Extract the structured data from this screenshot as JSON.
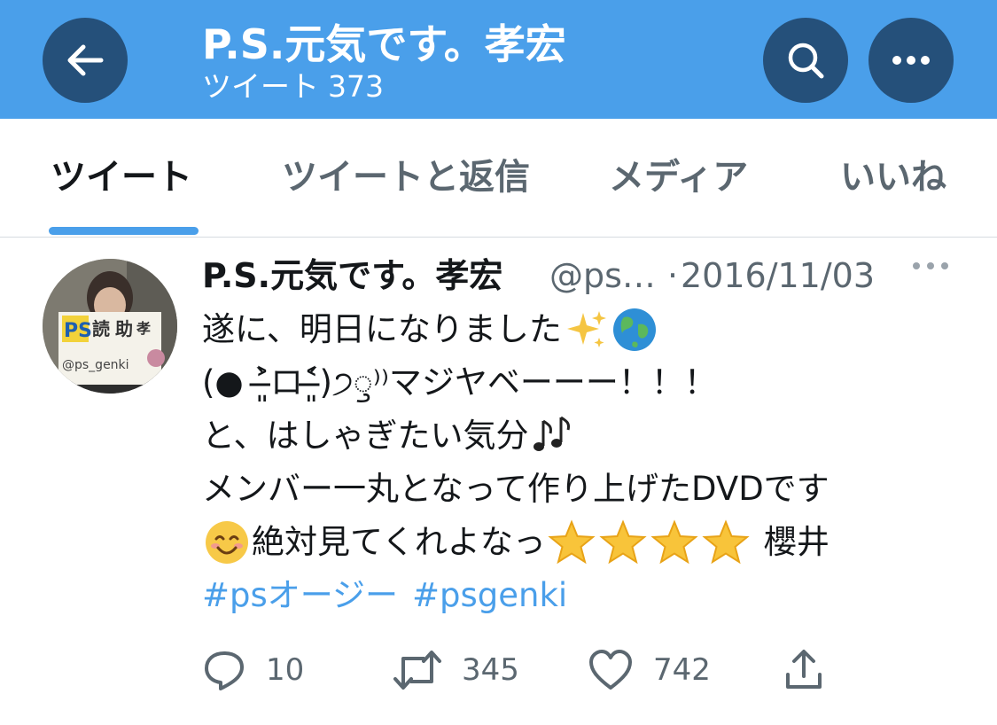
{
  "header": {
    "back_icon": "arrow-left-icon",
    "title": "P.S.元気です。孝宏",
    "subtitle_label": "ツイート",
    "subtitle_count": "373",
    "search_icon": "search-icon",
    "more_icon": "more-horizontal-icon",
    "bg_color": "#4a9fea",
    "button_color": "#25507a"
  },
  "tabs": [
    {
      "label": "ツイート",
      "active": true
    },
    {
      "label": "ツイートと返信",
      "active": false
    },
    {
      "label": "メディア",
      "active": false
    },
    {
      "label": "いいね",
      "active": false
    }
  ],
  "tweet": {
    "author_name": "P.S.元気です。孝宏",
    "author_handle": "@ps…",
    "separator": "·",
    "date": "2016/11/03",
    "avatar_text": "@ps_genki",
    "lines": [
      "遂に、明日になりました",
      "(● ˃̶͈̀ロ˂̶͈́)੭ꠥ⁾⁾マジヤベーーー！！！",
      "と、はしゃぎたい気分",
      "メンバー一丸となって作り上げたDVDです",
      "絶対見てくれよなっ",
      "櫻井"
    ],
    "hashtags": [
      "#psオージー",
      "#psgenki"
    ],
    "actions": {
      "reply_count": "10",
      "retweet_count": "345",
      "like_count": "742"
    }
  },
  "colors": {
    "accent": "#4a9fea",
    "text_primary": "#14171a",
    "text_secondary": "#5b6770"
  }
}
